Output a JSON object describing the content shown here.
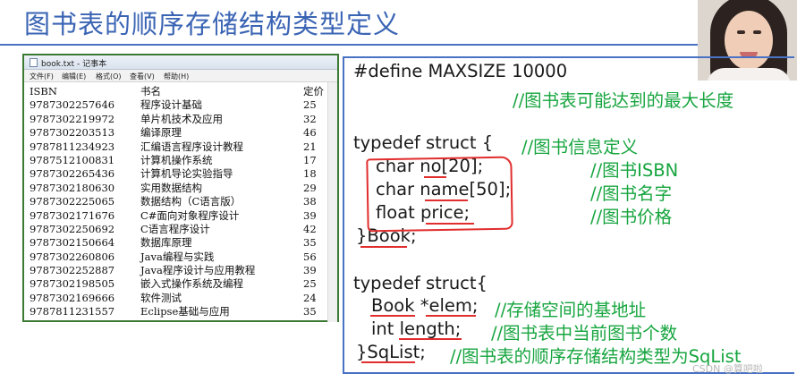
{
  "slide": {
    "title": "图书表的顺序存储结构类型定义",
    "watermark": "CSDN @算吧啦"
  },
  "notepad": {
    "window_title": "book.txt - 记事本",
    "menu": [
      "文件(F)",
      "编辑(E)",
      "格式(O)",
      "查看(V)",
      "帮助(H)"
    ],
    "header": {
      "isbn": "ISBN",
      "name": "书名",
      "price": "定价"
    },
    "rows": [
      {
        "isbn": "9787302257646",
        "name": "程序设计基础",
        "price": "25"
      },
      {
        "isbn": "9787302219972",
        "name": "单片机技术及应用",
        "price": "32"
      },
      {
        "isbn": "9787302203513",
        "name": "编译原理",
        "price": "46"
      },
      {
        "isbn": "9787811234923",
        "name": "汇编语言程序设计教程",
        "price": "21"
      },
      {
        "isbn": "9787512100831",
        "name": "计算机操作系统",
        "price": "17"
      },
      {
        "isbn": "9787302265436",
        "name": "计算机导论实验指导",
        "price": "18"
      },
      {
        "isbn": "9787302180630",
        "name": "实用数据结构",
        "price": "29"
      },
      {
        "isbn": "9787302225065",
        "name": "数据结构（C语言版）",
        "price": "38"
      },
      {
        "isbn": "9787302171676",
        "name": "C#面向对象程序设计",
        "price": "39"
      },
      {
        "isbn": "9787302250692",
        "name": "C语言程序设计",
        "price": "42"
      },
      {
        "isbn": "9787302150664",
        "name": "数据库原理",
        "price": "35"
      },
      {
        "isbn": "9787302260806",
        "name": "Java编程与实践",
        "price": "56"
      },
      {
        "isbn": "9787302252887",
        "name": "Java程序设计与应用教程",
        "price": "39"
      },
      {
        "isbn": "9787302198505",
        "name": "嵌入式操作系统及编程",
        "price": "25"
      },
      {
        "isbn": "9787302169666",
        "name": "软件测试",
        "price": "24"
      },
      {
        "isbn": "9787811231557",
        "name": "Eclipse基础与应用",
        "price": "35"
      }
    ]
  },
  "code": {
    "define_line": "#define MAXSIZE 10000",
    "define_comment": "//图书表可能达到的最大长度",
    "typedef1_open": "typedef struct   {",
    "typedef1_comment": "//图书信息定义",
    "field_no": "char no[20];",
    "field_no_comment": "//图书ISBN",
    "field_name": "char name[50];",
    "field_name_comment": "//图书名字",
    "field_price": "float price;",
    "field_price_comment": "//图书价格",
    "typedef1_close": "}Book;",
    "typedef2_open": "typedef struct{",
    "field_elem": "Book *elem;",
    "field_elem_comment": "//存储空间的基地址",
    "field_length": "int length;",
    "field_length_comment": "//图书表中当前图书个数",
    "typedef2_close": "}SqList;",
    "typedef2_comment": "//图书表的顺序存储结构类型为SqList"
  },
  "colors": {
    "title": "#3a64b4",
    "comment": "#17a53f",
    "annotation": "#e12d2d",
    "notepad_border": "#3c7a34"
  }
}
